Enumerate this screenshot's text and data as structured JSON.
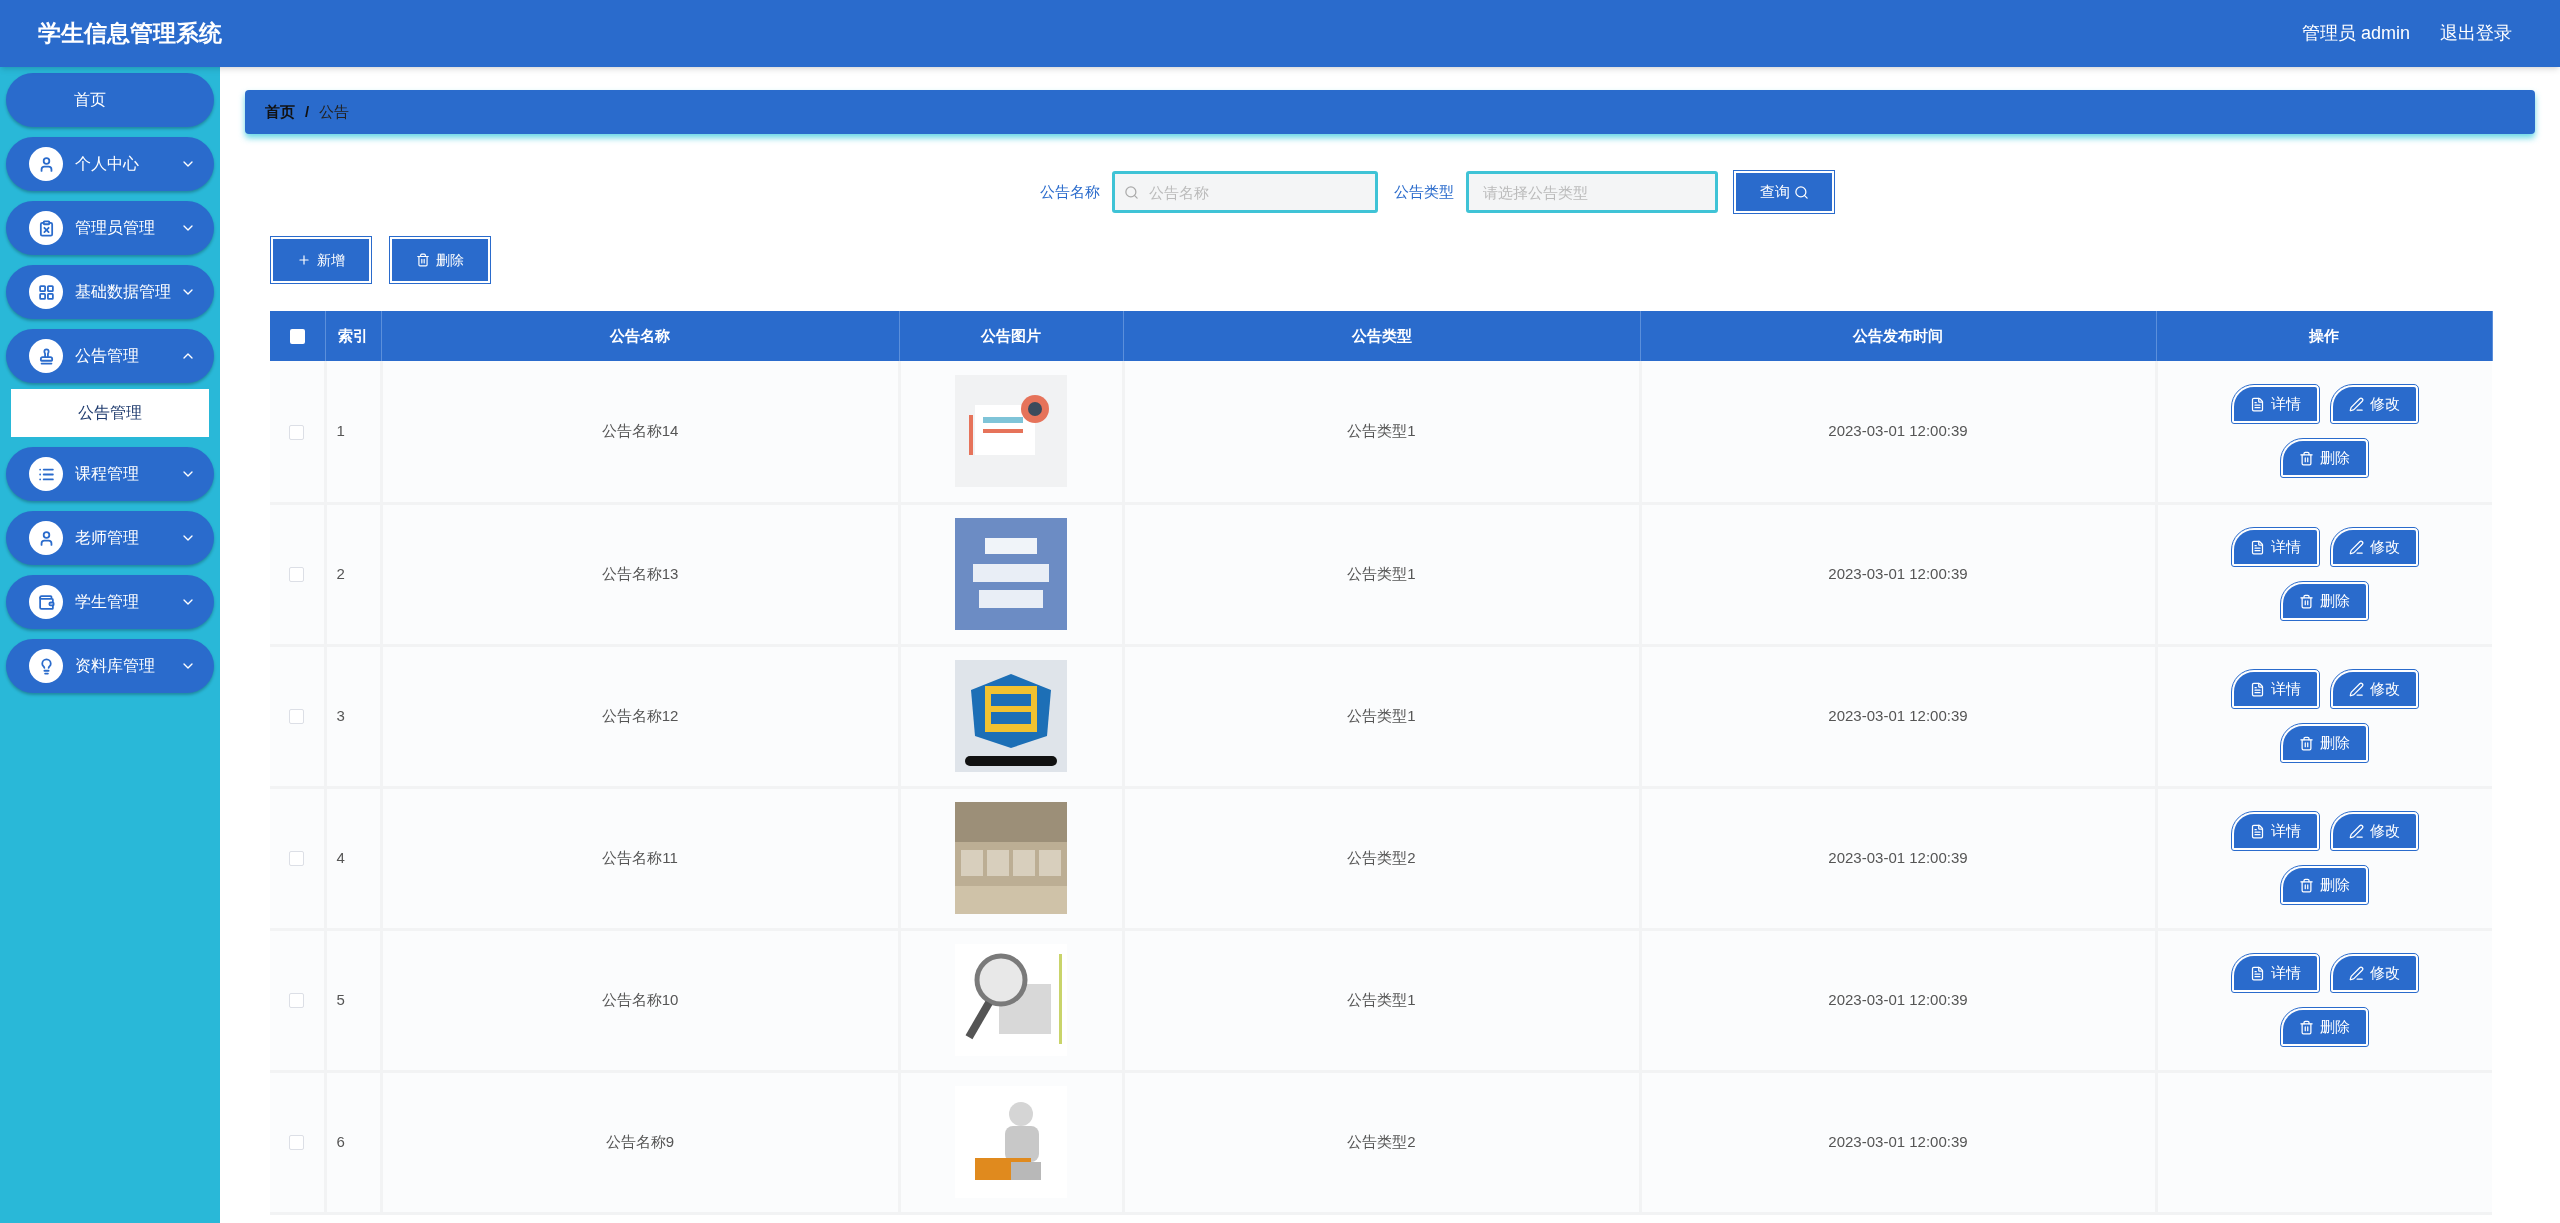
{
  "header": {
    "title": "学生信息管理系统",
    "user": "管理员 admin",
    "logout": "退出登录"
  },
  "sidebar": {
    "items": [
      {
        "label": "首页",
        "kind": "link"
      },
      {
        "label": "个人中心",
        "kind": "menu",
        "expanded": false
      },
      {
        "label": "管理员管理",
        "kind": "menu",
        "expanded": false
      },
      {
        "label": "基础数据管理",
        "kind": "menu",
        "expanded": false
      },
      {
        "label": "公告管理",
        "kind": "menu",
        "expanded": true,
        "children": [
          {
            "label": "公告管理",
            "selected": true
          }
        ]
      },
      {
        "label": "课程管理",
        "kind": "menu",
        "expanded": false
      },
      {
        "label": "老师管理",
        "kind": "menu",
        "expanded": false
      },
      {
        "label": "学生管理",
        "kind": "menu",
        "expanded": false
      },
      {
        "label": "资料库管理",
        "kind": "menu",
        "expanded": false
      }
    ]
  },
  "breadcrumb": {
    "items": [
      "首页",
      "公告"
    ],
    "separator": "/"
  },
  "search": {
    "fields": [
      {
        "label": "公告名称",
        "placeholder": "公告名称",
        "kind": "text"
      },
      {
        "label": "公告类型",
        "placeholder": "请选择公告类型",
        "kind": "select"
      }
    ],
    "button": "查询"
  },
  "toolbar": [
    {
      "label": "新增",
      "kind": "add"
    },
    {
      "label": "删除",
      "kind": "delete"
    }
  ],
  "table": {
    "all_checked": false,
    "columns": [
      "索引",
      "公告名称",
      "公告图片",
      "公告类型",
      "公告发布时间",
      "操作"
    ],
    "rows": [
      {
        "index": "1",
        "name": "公告名称14",
        "type": "公告类型1",
        "time": "2023-03-01 12:00:39",
        "checked": false,
        "actions": [
          "详情",
          "修改",
          "删除"
        ]
      },
      {
        "index": "2",
        "name": "公告名称13",
        "type": "公告类型1",
        "time": "2023-03-01 12:00:39",
        "checked": false,
        "actions": [
          "详情",
          "修改",
          "删除"
        ]
      },
      {
        "index": "3",
        "name": "公告名称12",
        "type": "公告类型1",
        "time": "2023-03-01 12:00:39",
        "checked": false,
        "actions": [
          "详情",
          "修改",
          "删除"
        ]
      },
      {
        "index": "4",
        "name": "公告名称11",
        "type": "公告类型2",
        "time": "2023-03-01 12:00:39",
        "checked": false,
        "actions": [
          "详情",
          "修改",
          "删除"
        ]
      },
      {
        "index": "5",
        "name": "公告名称10",
        "type": "公告类型1",
        "time": "2023-03-01 12:00:39",
        "checked": false,
        "actions": [
          "详情",
          "修改",
          "删除"
        ]
      },
      {
        "index": "6",
        "name": "公告名称9",
        "type": "公告类型2",
        "time": "2023-03-01 12:00:39",
        "checked": false
      }
    ]
  }
}
